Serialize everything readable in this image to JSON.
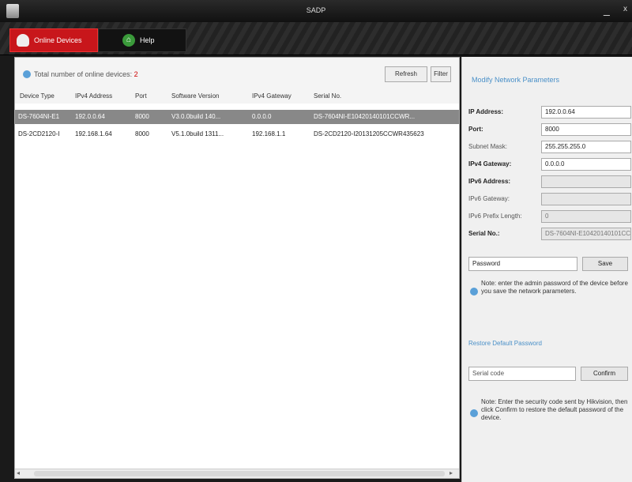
{
  "window": {
    "title": "SADP",
    "minimize": "_",
    "close": "x"
  },
  "toolbar": {
    "tabs": [
      {
        "label": "Online Devices"
      },
      {
        "label": "Help"
      }
    ]
  },
  "list": {
    "count_text": "Total number of online devices:",
    "count_value": "2",
    "refresh_label": "Refresh",
    "filter_label": "Filter",
    "columns": [
      "Device Type",
      "IPv4 Address",
      "Port",
      "Software Version",
      "IPv4 Gateway",
      "Serial No."
    ],
    "rows": [
      [
        "DS-7604NI-E1",
        "192.0.0.64",
        "8000",
        "V3.0.0build 140...",
        "0.0.0.0",
        "DS-7604NI-E10420140101CCWR..."
      ],
      [
        "DS-2CD2120-I",
        "192.168.1.64",
        "8000",
        "V5.1.0build 1311...",
        "192.168.1.1",
        "DS-2CD2120-I20131205CCWR435623"
      ]
    ]
  },
  "side": {
    "title": "Modify Network Parameters",
    "fields": [
      {
        "label": "IP Address:",
        "value": "192.0.0.64",
        "disabled": false,
        "strong": true
      },
      {
        "label": "Port:",
        "value": "8000",
        "disabled": false,
        "strong": true
      },
      {
        "label": "Subnet Mask:",
        "value": "255.255.255.0",
        "disabled": false,
        "strong": false
      },
      {
        "label": "IPv4 Gateway:",
        "value": "0.0.0.0",
        "disabled": false,
        "strong": true
      },
      {
        "label": "IPv6 Address:",
        "value": "",
        "disabled": true,
        "strong": true
      },
      {
        "label": "IPv6 Gateway:",
        "value": "",
        "disabled": true,
        "strong": false
      },
      {
        "label": "IPv6 Prefix Length:",
        "value": "0",
        "disabled": true,
        "strong": false
      },
      {
        "label": "Serial No.:",
        "value": "DS-7604NI-E10420140101CCWR...",
        "disabled": true,
        "strong": true
      }
    ],
    "password_placeholder": "Password",
    "save_label": "Save",
    "note1": "Note: enter the admin password of the device before you save the network parameters.",
    "restore_link": "Restore Default Password",
    "code_value": "Serial code",
    "confirm_label": "Confirm",
    "note2": "Note: Enter the security code sent by Hikvision, then click Confirm to restore the default password of the device."
  }
}
